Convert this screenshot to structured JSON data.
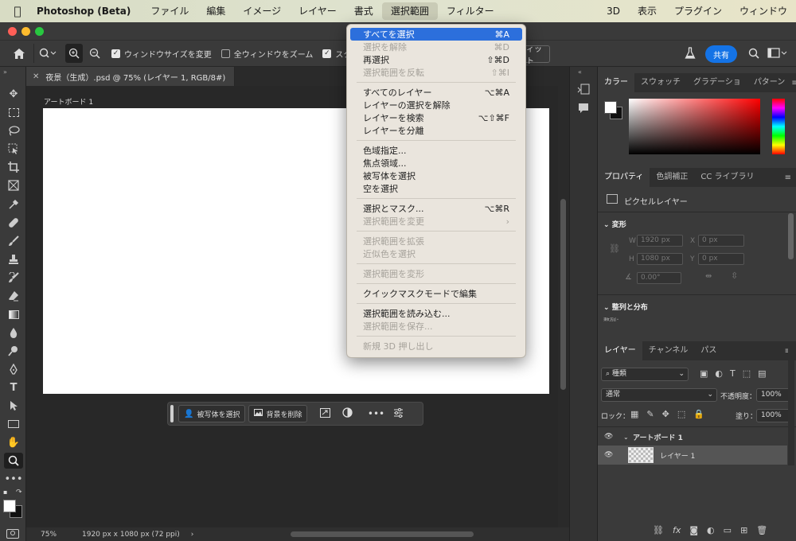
{
  "menubar": {
    "app_name": "Photoshop (Beta)",
    "items": [
      "ファイル",
      "編集",
      "イメージ",
      "レイヤー",
      "書式",
      "選択範囲",
      "フィルター"
    ],
    "right_items": [
      "3D",
      "表示",
      "プラグイン",
      "ウィンドウ"
    ]
  },
  "options_bar": {
    "resize_window_label": "ウィンドウサイズを変更",
    "zoom_all_label": "全ウィンドウをズーム",
    "scrubby_label_partial": "スク",
    "fit_label_partial": "ィット",
    "share_label": "共有"
  },
  "document": {
    "tab_title": "夜景（生成）.psd @ 75% (レイヤー 1, RGB/8#)",
    "artboard_label": "アートボード 1"
  },
  "context_bar": {
    "select_subject": "被写体を選択",
    "remove_bg": "背景を削除"
  },
  "status": {
    "zoom": "75%",
    "doc_info": "1920 px x 1080 px (72 ppi)"
  },
  "color_panel": {
    "tabs": [
      "カラー",
      "スウォッチ",
      "グラデーショ",
      "パターン"
    ]
  },
  "properties_panel": {
    "tabs": [
      "プロパティ",
      "色調補正",
      "CC ライブラリ"
    ],
    "layer_type": "ピクセルレイヤー",
    "transform_header": "変形",
    "w_label": "W",
    "w_value": "1920 px",
    "x_label": "X",
    "x_value": "0 px",
    "h_label": "H",
    "h_value": "1080 px",
    "y_label": "Y",
    "y_value": "0 px",
    "angle_value": "0.00°",
    "align_header": "整列と分布",
    "align_sub": "整列："
  },
  "layers_panel": {
    "tabs": [
      "レイヤー",
      "チャンネル",
      "パス"
    ],
    "filter_label": "種類",
    "blend_mode": "通常",
    "opacity_label": "不透明度：",
    "opacity_value": "100%",
    "lock_label": "ロック：",
    "fill_label": "塗り：",
    "fill_value": "100%",
    "layers": [
      {
        "name": "アートボード 1"
      },
      {
        "name": "レイヤー 1"
      }
    ]
  },
  "select_menu": {
    "items": [
      {
        "label": "すべてを選択",
        "shortcut": "⌘A",
        "state": "highlighted"
      },
      {
        "label": "選択を解除",
        "shortcut": "⌘D",
        "state": "disabled"
      },
      {
        "label": "再選択",
        "shortcut": "⇧⌘D",
        "state": "enabled"
      },
      {
        "label": "選択範囲を反転",
        "shortcut": "⇧⌘I",
        "state": "disabled"
      },
      {
        "label": "すべてのレイヤー",
        "shortcut": "⌥⌘A",
        "state": "enabled"
      },
      {
        "label": "レイヤーの選択を解除",
        "shortcut": "",
        "state": "enabled"
      },
      {
        "label": "レイヤーを検索",
        "shortcut": "⌥⇧⌘F",
        "state": "enabled"
      },
      {
        "label": "レイヤーを分離",
        "shortcut": "",
        "state": "enabled"
      },
      {
        "label": "色域指定...",
        "shortcut": "",
        "state": "enabled"
      },
      {
        "label": "焦点領域...",
        "shortcut": "",
        "state": "enabled"
      },
      {
        "label": "被写体を選択",
        "shortcut": "",
        "state": "enabled"
      },
      {
        "label": "空を選択",
        "shortcut": "",
        "state": "enabled"
      },
      {
        "label": "選択とマスク...",
        "shortcut": "⌥⌘R",
        "state": "enabled"
      },
      {
        "label": "選択範囲を変更",
        "shortcut": "›",
        "state": "disabled"
      },
      {
        "label": "選択範囲を拡張",
        "shortcut": "",
        "state": "disabled"
      },
      {
        "label": "近似色を選択",
        "shortcut": "",
        "state": "disabled"
      },
      {
        "label": "選択範囲を変形",
        "shortcut": "",
        "state": "disabled"
      },
      {
        "label": "クイックマスクモードで編集",
        "shortcut": "",
        "state": "enabled"
      },
      {
        "label": "選択範囲を読み込む...",
        "shortcut": "",
        "state": "enabled"
      },
      {
        "label": "選択範囲を保存...",
        "shortcut": "",
        "state": "disabled"
      },
      {
        "label": "新規 3D 押し出し",
        "shortcut": "",
        "state": "disabled"
      }
    ]
  }
}
